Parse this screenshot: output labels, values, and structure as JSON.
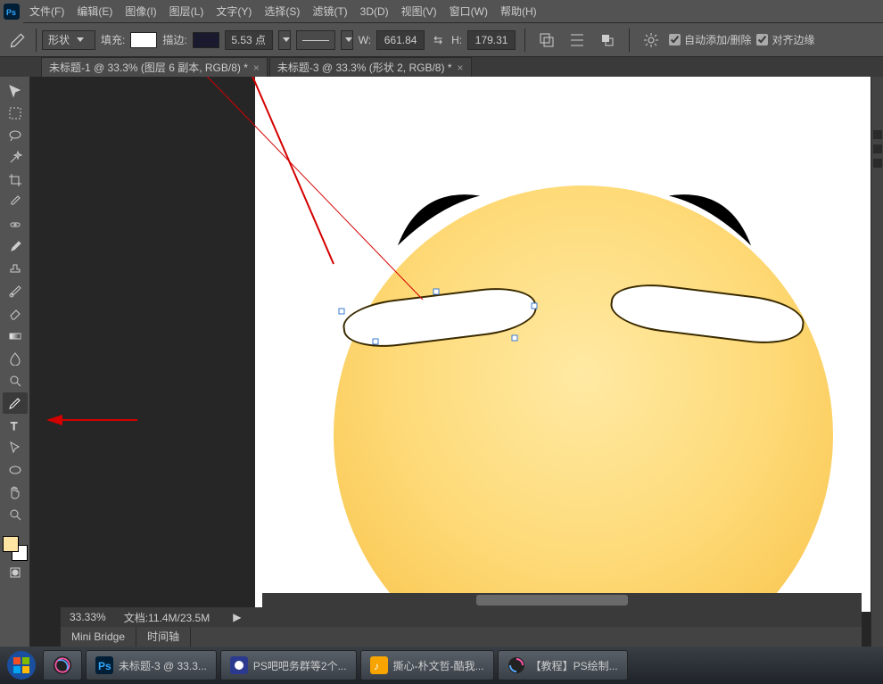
{
  "menu": {
    "items": [
      "文件(F)",
      "编辑(E)",
      "图像(I)",
      "图层(L)",
      "文字(Y)",
      "选择(S)",
      "滤镜(T)",
      "3D(D)",
      "视图(V)",
      "窗口(W)",
      "帮助(H)"
    ]
  },
  "options": {
    "mode_label": "形状",
    "fill_label": "填充:",
    "stroke_label": "描边:",
    "stroke_size": "5.53 点",
    "w_label": "W:",
    "w_value": "661.84",
    "h_label": "H:",
    "h_value": "179.31",
    "chk1": "自动添加/删除",
    "chk2": "对齐边缘",
    "fill_color": "#ffffff",
    "stroke_color": "#1a1a2e"
  },
  "tabs": [
    {
      "title": "未标题-1 @ 33.3% (图层 6 副本, RGB/8) *",
      "active": false
    },
    {
      "title": "未标题-3 @ 33.3% (形状 2, RGB/8) *",
      "active": true
    }
  ],
  "status": {
    "zoom": "33.33%",
    "doc": "文档:11.4M/23.5M"
  },
  "panel_tabs": [
    "Mini Bridge",
    "时间轴"
  ],
  "colors": {
    "fg": "#ffe5a3",
    "bg": "#ffffff",
    "accent_red": "#d40000"
  },
  "taskbar": [
    {
      "icon": "ps",
      "label": "未标题-3 @ 33.3..."
    },
    {
      "icon": "chat",
      "label": "PS吧吧务群等2个..."
    },
    {
      "icon": "music",
      "label": "撕心-朴文哲-酷我..."
    },
    {
      "icon": "browser",
      "label": "【教程】PS绘制..."
    }
  ]
}
